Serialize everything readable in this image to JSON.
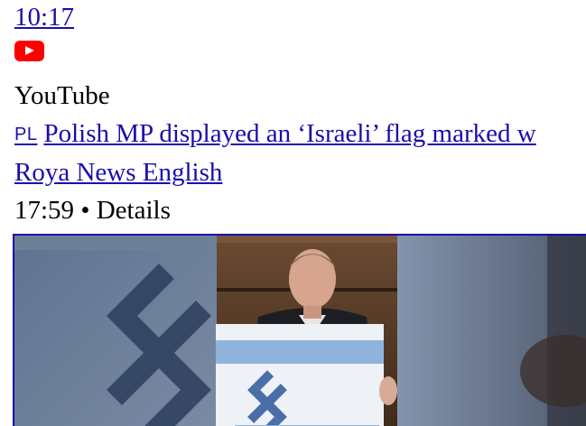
{
  "result": {
    "timestamp": "10:17",
    "source_icon": "youtube-play-icon",
    "source": "YouTube",
    "lang_badge": "PL",
    "title": "Polish MP displayed an ‘Israeli’ flag marked w",
    "channel": "Roya News English",
    "duration": "17:59",
    "separator": "•",
    "details": "Details"
  },
  "colors": {
    "link": "#1a0dab",
    "youtube_red": "#ff0000"
  }
}
